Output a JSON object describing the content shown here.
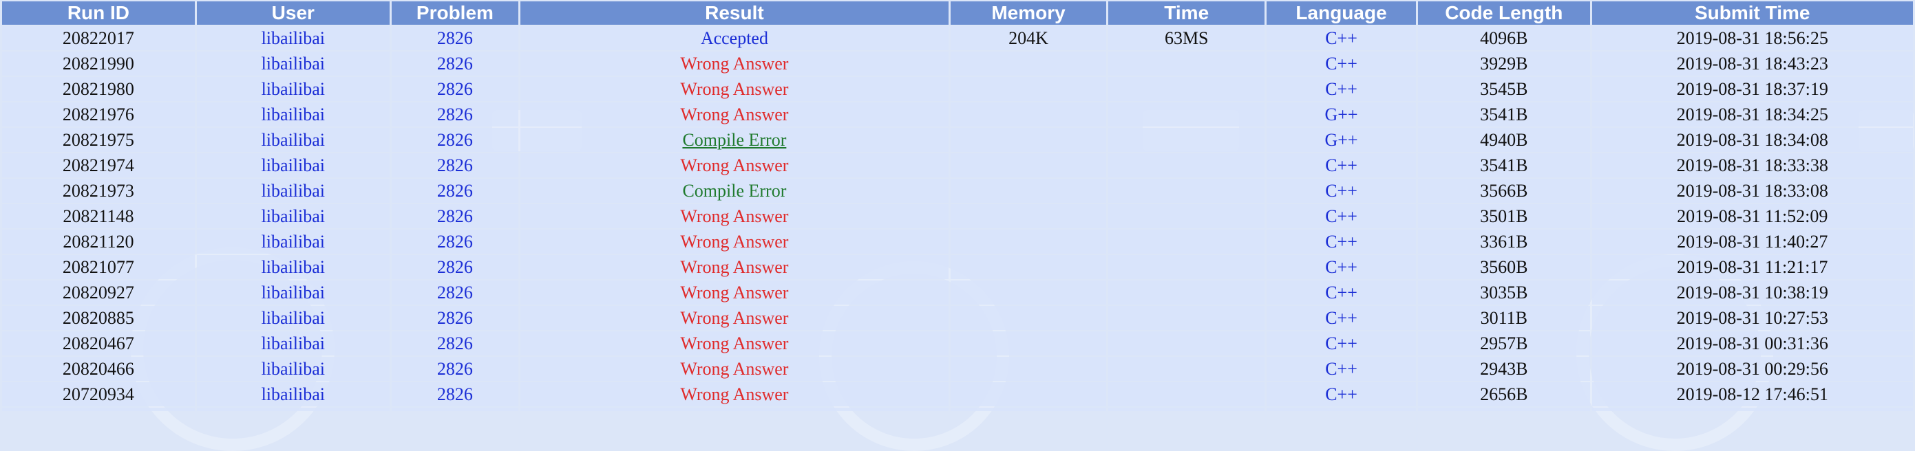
{
  "table": {
    "headers": [
      "Run ID",
      "User",
      "Problem",
      "Result",
      "Memory",
      "Time",
      "Language",
      "Code Length",
      "Submit Time"
    ],
    "rows": [
      {
        "run_id": "20822017",
        "user": "libailibai",
        "problem": "2826",
        "result": "Accepted",
        "result_type": "ac",
        "memory": "204K",
        "time": "63MS",
        "language": "C++",
        "code_length": "4096B",
        "submit_time": "2019-08-31 18:56:25"
      },
      {
        "run_id": "20821990",
        "user": "libailibai",
        "problem": "2826",
        "result": "Wrong Answer",
        "result_type": "wa",
        "memory": "",
        "time": "",
        "language": "C++",
        "code_length": "3929B",
        "submit_time": "2019-08-31 18:43:23"
      },
      {
        "run_id": "20821980",
        "user": "libailibai",
        "problem": "2826",
        "result": "Wrong Answer",
        "result_type": "wa",
        "memory": "",
        "time": "",
        "language": "C++",
        "code_length": "3545B",
        "submit_time": "2019-08-31 18:37:19"
      },
      {
        "run_id": "20821976",
        "user": "libailibai",
        "problem": "2826",
        "result": "Wrong Answer",
        "result_type": "wa",
        "memory": "",
        "time": "",
        "language": "G++",
        "code_length": "3541B",
        "submit_time": "2019-08-31 18:34:25"
      },
      {
        "run_id": "20821975",
        "user": "libailibai",
        "problem": "2826",
        "result": "Compile Error",
        "result_type": "ce-link",
        "memory": "",
        "time": "",
        "language": "G++",
        "code_length": "4940B",
        "submit_time": "2019-08-31 18:34:08"
      },
      {
        "run_id": "20821974",
        "user": "libailibai",
        "problem": "2826",
        "result": "Wrong Answer",
        "result_type": "wa",
        "memory": "",
        "time": "",
        "language": "C++",
        "code_length": "3541B",
        "submit_time": "2019-08-31 18:33:38"
      },
      {
        "run_id": "20821973",
        "user": "libailibai",
        "problem": "2826",
        "result": "Compile Error",
        "result_type": "ce",
        "memory": "",
        "time": "",
        "language": "C++",
        "code_length": "3566B",
        "submit_time": "2019-08-31 18:33:08"
      },
      {
        "run_id": "20821148",
        "user": "libailibai",
        "problem": "2826",
        "result": "Wrong Answer",
        "result_type": "wa",
        "memory": "",
        "time": "",
        "language": "C++",
        "code_length": "3501B",
        "submit_time": "2019-08-31 11:52:09"
      },
      {
        "run_id": "20821120",
        "user": "libailibai",
        "problem": "2826",
        "result": "Wrong Answer",
        "result_type": "wa",
        "memory": "",
        "time": "",
        "language": "C++",
        "code_length": "3361B",
        "submit_time": "2019-08-31 11:40:27"
      },
      {
        "run_id": "20821077",
        "user": "libailibai",
        "problem": "2826",
        "result": "Wrong Answer",
        "result_type": "wa",
        "memory": "",
        "time": "",
        "language": "C++",
        "code_length": "3560B",
        "submit_time": "2019-08-31 11:21:17"
      },
      {
        "run_id": "20820927",
        "user": "libailibai",
        "problem": "2826",
        "result": "Wrong Answer",
        "result_type": "wa",
        "memory": "",
        "time": "",
        "language": "C++",
        "code_length": "3035B",
        "submit_time": "2019-08-31 10:38:19"
      },
      {
        "run_id": "20820885",
        "user": "libailibai",
        "problem": "2826",
        "result": "Wrong Answer",
        "result_type": "wa",
        "memory": "",
        "time": "",
        "language": "C++",
        "code_length": "3011B",
        "submit_time": "2019-08-31 10:27:53"
      },
      {
        "run_id": "20820467",
        "user": "libailibai",
        "problem": "2826",
        "result": "Wrong Answer",
        "result_type": "wa",
        "memory": "",
        "time": "",
        "language": "C++",
        "code_length": "2957B",
        "submit_time": "2019-08-31 00:31:36"
      },
      {
        "run_id": "20820466",
        "user": "libailibai",
        "problem": "2826",
        "result": "Wrong Answer",
        "result_type": "wa",
        "memory": "",
        "time": "",
        "language": "C++",
        "code_length": "2943B",
        "submit_time": "2019-08-31 00:29:56"
      },
      {
        "run_id": "20720934",
        "user": "libailibai",
        "problem": "2826",
        "result": "Wrong Answer",
        "result_type": "wa",
        "memory": "",
        "time": "",
        "language": "C++",
        "code_length": "2656B",
        "submit_time": "2019-08-12 17:46:51"
      }
    ]
  },
  "colors": {
    "header_bg": "#6c8fd2",
    "row_bg": "#dce6f8",
    "link": "#1c2fd6",
    "wrong_answer": "#e02a2a",
    "compile_error": "#1f7a2e"
  }
}
